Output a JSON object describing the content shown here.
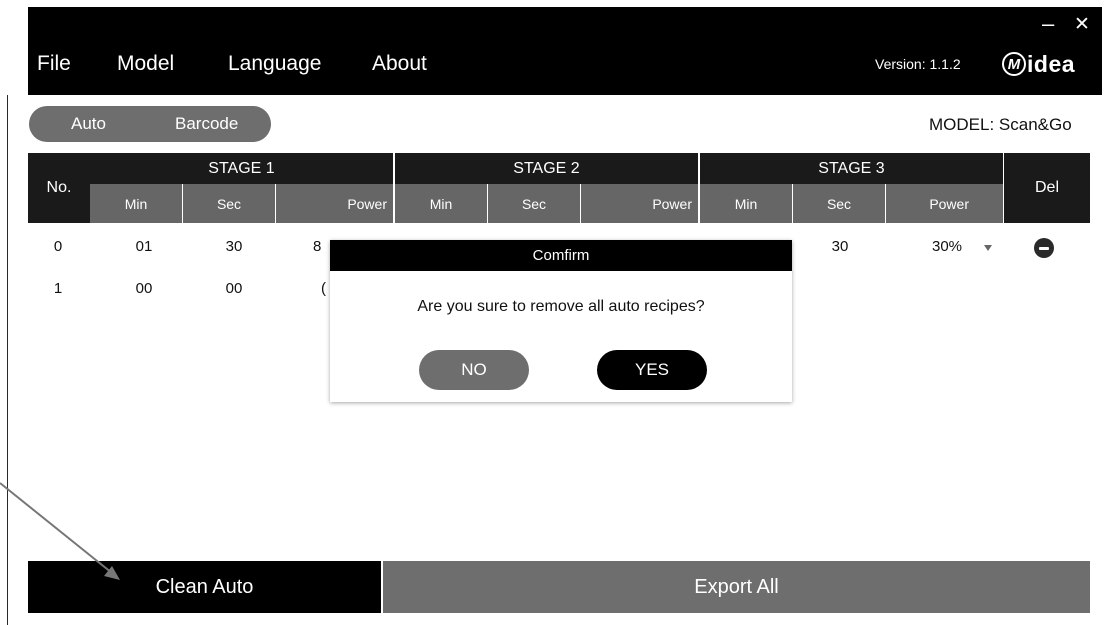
{
  "menu": {
    "file": "File",
    "model": "Model",
    "language": "Language",
    "about": "About"
  },
  "window_controls": {
    "minimize": "–",
    "close": "✕"
  },
  "version": "Version: 1.1.2",
  "logo": {
    "letter": "M",
    "text": "idea"
  },
  "mode_toggle": {
    "auto": "Auto",
    "barcode": "Barcode"
  },
  "model_label": "MODEL: Scan&Go",
  "table": {
    "no_header": "No.",
    "del_header": "Del",
    "stages": [
      "STAGE 1",
      "STAGE 2",
      "STAGE 3"
    ],
    "sub_headers": [
      "Min",
      "Sec",
      "Power"
    ],
    "rows": [
      {
        "no": "0",
        "s1_min": "01",
        "s1_sec": "30",
        "s1_power_partial": "8",
        "s3_sec": "30",
        "s3_power": "30%"
      },
      {
        "no": "1",
        "s1_min": "00",
        "s1_sec": "00",
        "s1_power_partial": "("
      }
    ]
  },
  "dialog": {
    "title": "Comfirm",
    "message": "Are you sure to remove all auto recipes?",
    "no": "NO",
    "yes": "YES"
  },
  "bottom": {
    "clean_auto": "Clean Auto",
    "export_all": "Export All"
  },
  "colors": {
    "title_bar": "#000000",
    "header_dark": "#1a1a1a",
    "header_sub": "#666666",
    "toggle": "#6e6e6e",
    "export_bar": "#6e6e6e"
  }
}
